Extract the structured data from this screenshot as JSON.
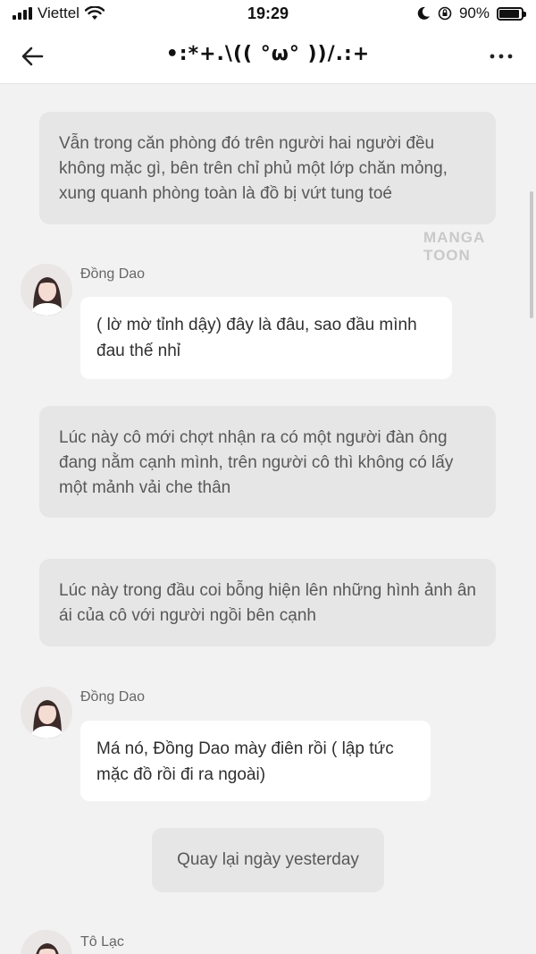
{
  "status_bar": {
    "carrier": "Viettel",
    "time": "19:29",
    "battery": "90%",
    "battery_level": 0.9
  },
  "header": {
    "title": "•:*+.\\(( °ω° ))/.:+"
  },
  "watermark": "MANGA TOON",
  "messages": [
    {
      "type": "narration",
      "text": "Vẫn trong căn phòng đó trên người hai người đều không mặc gì, bên trên chỉ phủ một lớp chăn mỏng, xung quanh phòng toàn là đồ bị vứt tung toé"
    },
    {
      "type": "character",
      "name": "Đồng Dao",
      "text": "( lờ mờ tỉnh dậy) đây là đâu, sao đầu mình đau thế nhỉ"
    },
    {
      "type": "narration",
      "text": "Lúc này cô mới chợt nhận ra có một người đàn ông đang nằm cạnh mình, trên người cô thì không có lấy một mảnh vải che thân"
    },
    {
      "type": "narration",
      "text": "Lúc này trong đầu coi bỗng hiện lên những hình ảnh ân ái của cô với người ngồi bên cạnh"
    },
    {
      "type": "character",
      "name": "Đồng Dao",
      "text": "Má nó, Đồng Dao mày điên rồi ( lập tức mặc đồ rồi đi ra ngoài)"
    },
    {
      "type": "system",
      "text": "Quay lại ngày yesterday"
    },
    {
      "type": "character",
      "name": "Tô Lạc",
      "text": ""
    }
  ],
  "icons": {
    "back": "arrow-left-icon",
    "more": "more-horizontal-icon",
    "wifi": "wifi-icon",
    "signal": "signal-bars-icon",
    "moon": "moon-icon",
    "orientation_lock": "orientation-lock-icon",
    "battery": "battery-icon"
  }
}
